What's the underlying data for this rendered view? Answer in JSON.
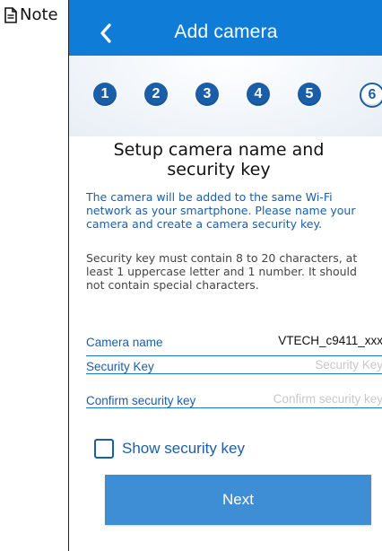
{
  "note": {
    "label": "Note"
  },
  "nav": {
    "title": "Add camera",
    "back_icon": "chevron-left-icon"
  },
  "steps": [
    "1",
    "2",
    "3",
    "4",
    "5",
    "6"
  ],
  "active_step": "6",
  "heading": "Setup camera name and security key",
  "info_text": "The camera will be added to the same Wi-Fi network as your smartphone. Please name your camera and create a camera security key.",
  "rules_text": "Security key must contain 8 to 20 characters, at least 1 uppercase letter and 1 number. It should not contain special characters.",
  "fields": {
    "camera_name": {
      "label": "Camera name",
      "value": "VTECH_c9411_xxx"
    },
    "security_key": {
      "label": "Security Key",
      "placeholder": "Security Key"
    },
    "confirm_key": {
      "label": "Confirm security key",
      "placeholder": "Confirm security key"
    }
  },
  "show_key": {
    "label": "Show security key",
    "checked": false
  },
  "next_button": {
    "label": "Next"
  },
  "colors": {
    "nav_background": "#0f7dd8",
    "accent_blue": "#1b5ea8",
    "button_blue": "#3e8ed6"
  }
}
